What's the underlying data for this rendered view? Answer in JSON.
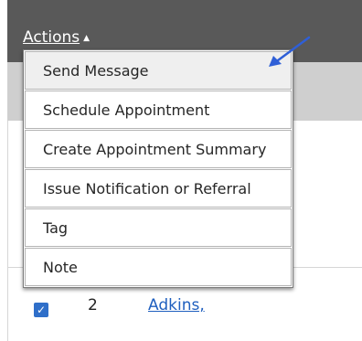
{
  "toolbar": {
    "actions_label": "Actions",
    "actions_caret_icon": "caret-up-icon"
  },
  "menu": {
    "items": [
      {
        "label": "Send Message",
        "active": true
      },
      {
        "label": "Schedule Appointment"
      },
      {
        "label": "Create Appointment Summary"
      },
      {
        "label": "Issue Notification or Referral"
      },
      {
        "label": "Tag"
      },
      {
        "label": "Note"
      }
    ]
  },
  "table": {
    "row": {
      "checked": true,
      "number": "2",
      "name": "Adkins,"
    }
  },
  "annotation": {
    "arrow_icon": "pointer-arrow-icon",
    "arrow_color": "#2f5fd7"
  },
  "colors": {
    "topbar": "#595959",
    "band": "#cfcfcf",
    "link": "#1f5fbf",
    "checkbox": "#2f6fc9"
  }
}
